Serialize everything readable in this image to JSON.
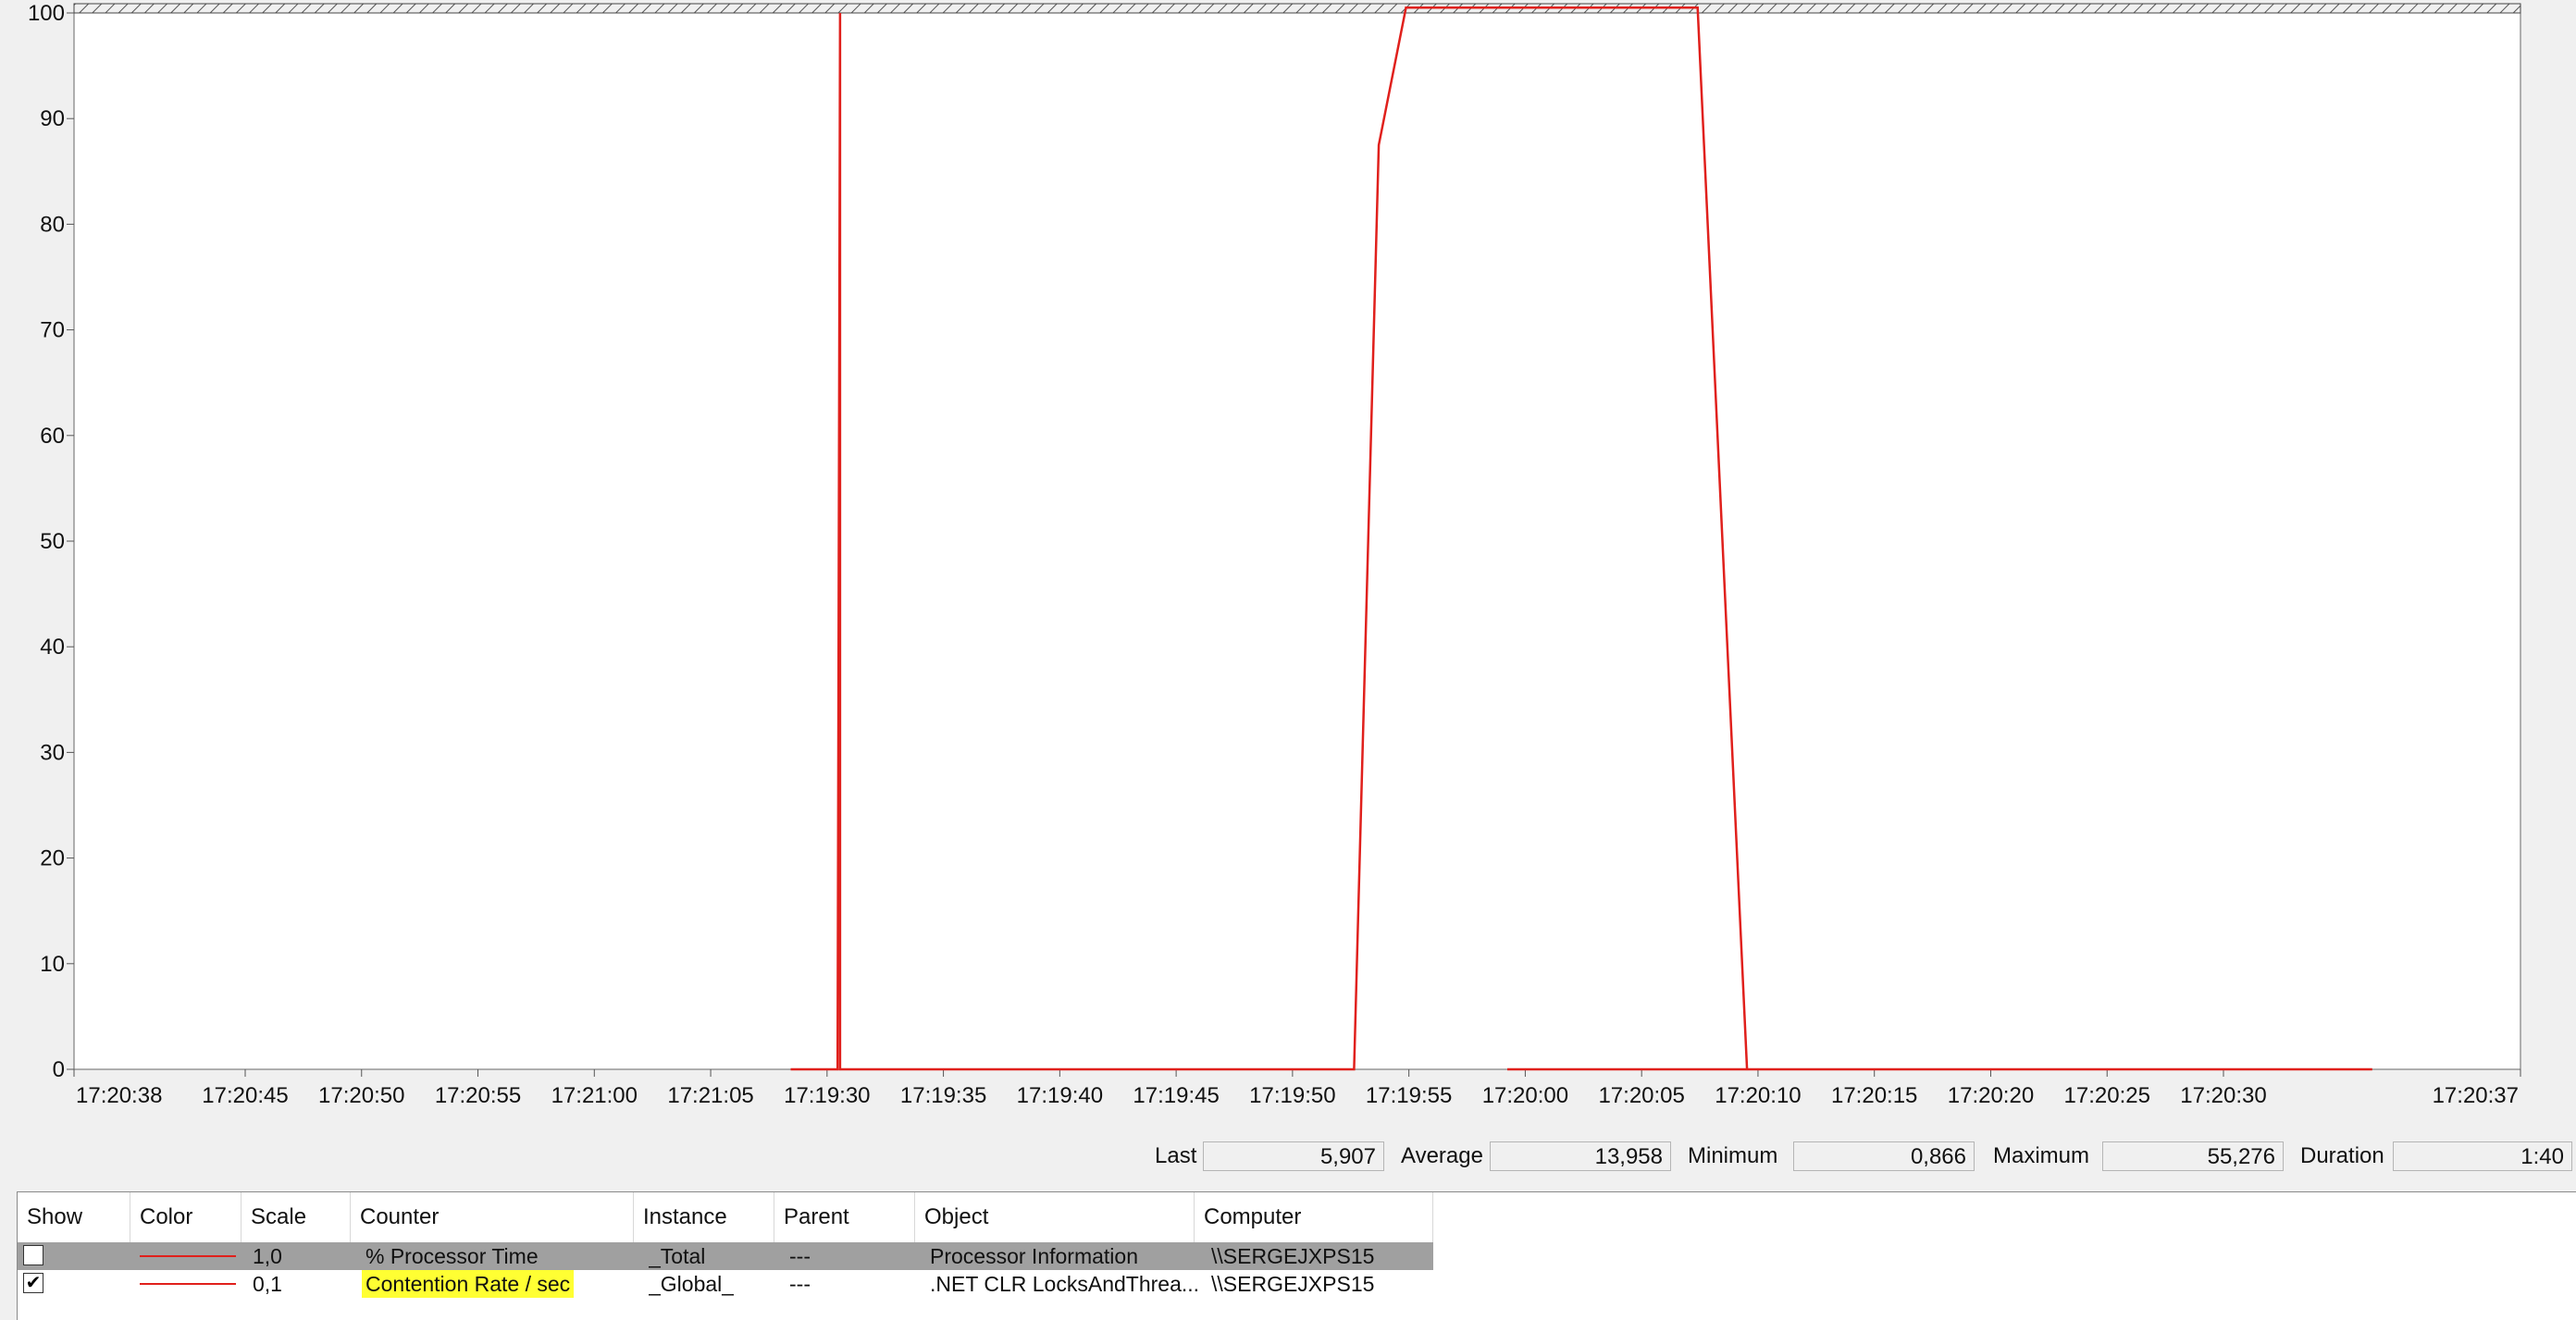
{
  "chart_data": {
    "type": "line",
    "ylim": [
      0,
      100
    ],
    "y_ticks": [
      "0",
      "10",
      "20",
      "30",
      "40",
      "50",
      "60",
      "70",
      "80",
      "90",
      "100"
    ],
    "x_ticks": [
      "17:20:38",
      "17:20:45",
      "17:20:50",
      "17:20:55",
      "17:21:00",
      "17:21:05",
      "17:19:30",
      "17:19:35",
      "17:19:40",
      "17:19:45",
      "17:19:50",
      "17:19:55",
      "17:20:00",
      "17:20:05",
      "17:20:10",
      "17:20:15",
      "17:20:20",
      "17:20:25",
      "17:20:30",
      "17:20:37"
    ],
    "x_range": [
      0,
      99
    ],
    "grid": false,
    "series": [
      {
        "color": "#e0201c",
        "x": [
          58,
          58.4,
          58.6,
          58.8,
          59,
          78,
          79,
          80,
          81,
          82,
          83,
          84,
          85,
          86,
          87,
          88,
          89,
          90,
          91,
          92,
          93
        ],
        "y": [
          0,
          0,
          0,
          0,
          0,
          0,
          0,
          0,
          0,
          0,
          0,
          0,
          0,
          0,
          0,
          0,
          0,
          0,
          0,
          0,
          0
        ]
      },
      {
        "color": "#e0201c",
        "x": [
          29,
          30.9,
          31.0,
          31.0,
          51.8,
          52.8,
          53.9,
          65.7,
          67.7
        ],
        "y": [
          0,
          0,
          100,
          0,
          0,
          87.5,
          100.5,
          100.5,
          0
        ]
      }
    ]
  },
  "stats": {
    "last_label": "Last",
    "last_value": "5,907",
    "average_label": "Average",
    "average_value": "13,958",
    "minimum_label": "Minimum",
    "minimum_value": "0,866",
    "maximum_label": "Maximum",
    "maximum_value": "55,276",
    "duration_label": "Duration",
    "duration_value": "1:40"
  },
  "legend": {
    "headers": [
      "Show",
      "Color",
      "Scale",
      "Counter",
      "Instance",
      "Parent",
      "Object",
      "Computer"
    ],
    "rows": [
      {
        "checked": false,
        "color": "#e0201c",
        "scale": "1,0",
        "counter": "% Processor Time",
        "instance": "_Total",
        "parent": "---",
        "object": "Processor Information",
        "computer": "\\\\SERGEJXPS15"
      },
      {
        "checked": true,
        "check_glyph": "✔",
        "color": "#e0201c",
        "scale": "0,1",
        "counter": "Contention Rate / sec",
        "instance": "_Global_",
        "parent": "---",
        "object": ".NET CLR LocksAndThrea...",
        "computer": "\\\\SERGEJXPS15"
      }
    ]
  }
}
